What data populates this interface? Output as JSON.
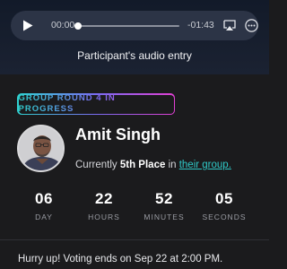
{
  "player": {
    "current_time": "00:00",
    "remaining_time": "-01:43",
    "progress": 0,
    "icons": [
      "play-icon",
      "airplay-icon",
      "more-icon"
    ]
  },
  "caption": "Participant's audio entry",
  "card": {
    "status_badge": "GROUP ROUND 4 IN PROGRESS",
    "name": "Amit Singh",
    "rank_prefix": "Currently",
    "rank_value": "5th Place",
    "rank_middle": "in",
    "rank_link": "their group."
  },
  "countdown": [
    {
      "value": "06",
      "label": "DAY"
    },
    {
      "value": "22",
      "label": "HOURS"
    },
    {
      "value": "52",
      "label": "MINUTES"
    },
    {
      "value": "05",
      "label": "SECONDS"
    }
  ],
  "voting_notice": "Hurry up! Voting ends on Sep 22 at 2:00 PM.",
  "colors": {
    "accent_teal": "#2fc9c7",
    "badge_gradient_start": "#2fd2d0",
    "badge_gradient_end": "#e03fd3",
    "card_bg": "#1b1b1d",
    "player_bg": "#2c3446"
  }
}
